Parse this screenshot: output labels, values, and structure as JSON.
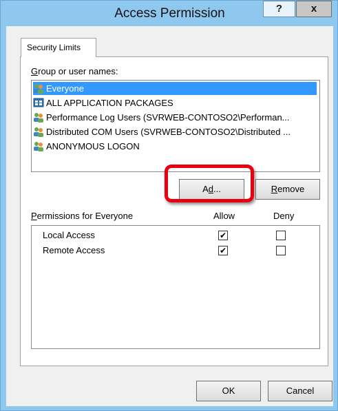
{
  "window": {
    "title": "Access Permission",
    "help_label": "?",
    "close_label": "x"
  },
  "tab": {
    "label": "Security Limits"
  },
  "group": {
    "label": "Group or user names:",
    "mnemonic": "G",
    "label_rest": "roup or user names:",
    "items": [
      {
        "name": "Everyone",
        "icon": "users-group-icon",
        "selected": true
      },
      {
        "name": "ALL APPLICATION PACKAGES",
        "icon": "app-package-icon",
        "selected": false
      },
      {
        "name": "Performance Log Users (SVRWEB-CONTOSO2\\Performan...",
        "icon": "users-group-icon",
        "selected": false
      },
      {
        "name": "Distributed COM Users (SVRWEB-CONTOSO2\\Distributed ...",
        "icon": "users-group-icon",
        "selected": false
      },
      {
        "name": "ANONYMOUS LOGON",
        "icon": "users-group-icon",
        "selected": false
      }
    ]
  },
  "buttons": {
    "add": "Add...",
    "add_pre": "A",
    "add_mnemonic": "d",
    "add_post": "d...",
    "remove_mnemonic": "R",
    "remove_rest": "emove",
    "remove": "Remove",
    "ok": "OK",
    "cancel": "Cancel"
  },
  "permissions": {
    "label": "Permissions for Everyone",
    "mnemonic": "P",
    "label_rest": "ermissions for Everyone",
    "allow_header": "Allow",
    "deny_header": "Deny",
    "rows": [
      {
        "name": "Local Access",
        "allow": true,
        "deny": false
      },
      {
        "name": "Remote Access",
        "allow": true,
        "deny": false
      }
    ]
  },
  "colors": {
    "selection": "#3399ff",
    "highlight": "#e8000f",
    "frame": "#8ec8ef"
  }
}
